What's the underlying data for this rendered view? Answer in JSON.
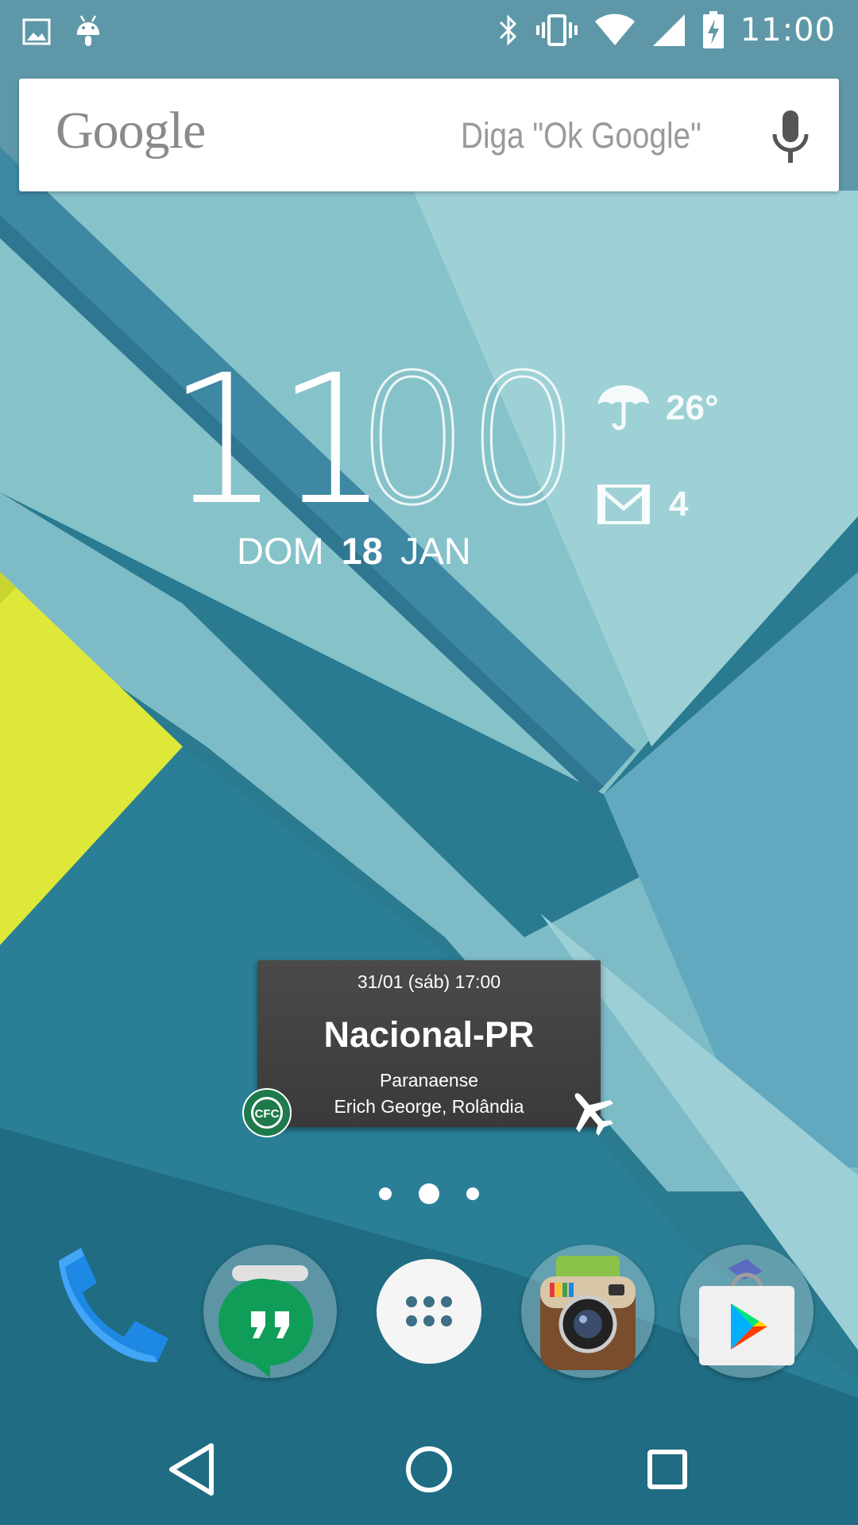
{
  "status_bar": {
    "time": "11:00",
    "left_icons": [
      "image-icon",
      "android-icon"
    ],
    "right_icons": [
      "bluetooth-icon",
      "vibrate-icon",
      "wifi-icon",
      "signal-icon",
      "battery-charging-icon"
    ]
  },
  "search": {
    "logo": "Google",
    "hint": "Diga \"Ok Google\"",
    "icon": "mic-icon"
  },
  "clock": {
    "hours": "11",
    "minutes": "00",
    "weekday": "DOM",
    "day": "18",
    "month": "JAN",
    "temperature": "26°",
    "weather_icon": "umbrella-icon",
    "mail_icon": "gmail-icon",
    "unread_mail": "4"
  },
  "event": {
    "datetime": "31/01 (sáb) 17:00",
    "opponent": "Nacional-PR",
    "competition": "Paranaense",
    "venue": "Erich George, Rolândia",
    "team_badge_text": "CFC",
    "travel_icon": "airplane-icon"
  },
  "pages": {
    "count": 3,
    "active": 2
  },
  "dock": {
    "apps": [
      "phone-icon",
      "hangouts-folder-icon",
      "app-drawer-icon",
      "instagram-folder-icon",
      "play-store-folder-icon"
    ]
  },
  "nav": {
    "buttons": [
      "back-icon",
      "home-icon",
      "recents-icon"
    ]
  },
  "colors": {
    "wallpaper_dark": "#24778f",
    "wallpaper_mid": "#5aa3b4",
    "wallpaper_light": "#9cd0d5",
    "accent_yellow": "#dfe83a",
    "event_card": "#424242",
    "hangouts_green": "#0f9d58"
  }
}
